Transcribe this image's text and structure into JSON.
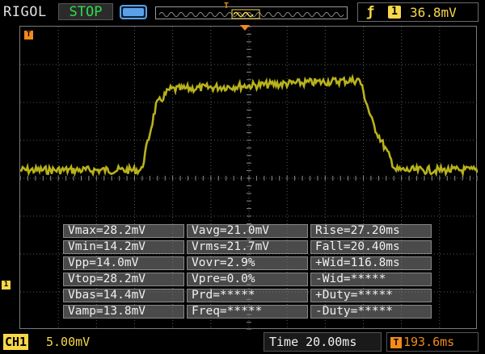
{
  "header": {
    "brand": "RIGOL",
    "run_state": "STOP",
    "timebase_marker": "T",
    "trigger": {
      "edge_icon": "rising-edge-icon",
      "channel": "1",
      "level": "36.8mV"
    }
  },
  "markers": {
    "trigger_marker": "T",
    "ch1_marker": "1"
  },
  "measurements": {
    "rows": [
      [
        "Vmax=28.2mV",
        "Vavg=21.0mV",
        "Rise=27.20ms"
      ],
      [
        "Vmin=14.2mV",
        "Vrms=21.7mV",
        "Fall=20.40ms"
      ],
      [
        "Vpp=14.0mV",
        "Vovr=2.9%",
        "+Wid=116.8ms"
      ],
      [
        "Vtop=28.2mV",
        "Vpre=0.0%",
        "-Wid=*****"
      ],
      [
        "Vbas=14.4mV",
        "Prd=*****",
        "+Duty=*****"
      ],
      [
        "Vamp=13.8mV",
        "Freq=*****",
        "-Duty=*****"
      ]
    ]
  },
  "footer": {
    "ch1_label": "CH1",
    "ch1_scale": "5.00mV",
    "time_label": "Time 20.00ms",
    "trigger_offset": "193.6ms"
  },
  "colors": {
    "ch1": "#f7d84a",
    "trace": "#b8b21c",
    "trigger": "#f28a1c",
    "grid": "#5a5a5a"
  }
}
